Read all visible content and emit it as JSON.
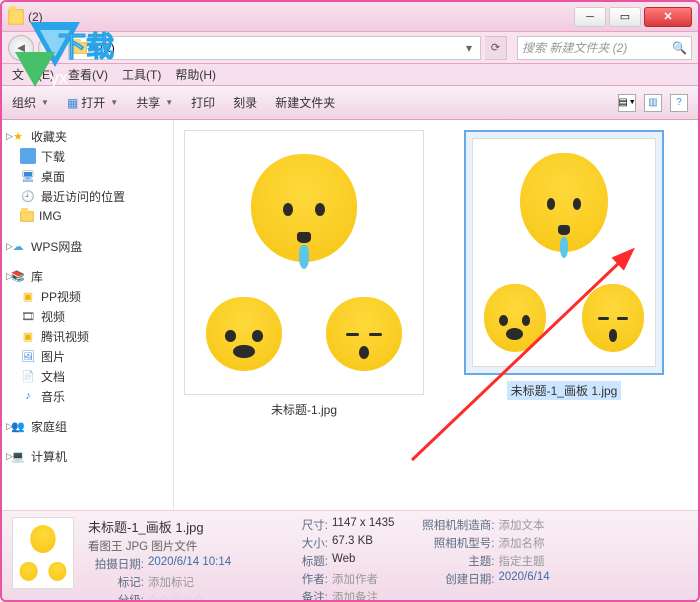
{
  "window": {
    "title_folder": "(2)"
  },
  "address": {
    "breadcrumb": "(2)",
    "refresh": "⟳"
  },
  "search": {
    "placeholder": "搜索 新建文件夹 (2)",
    "icon": "🔍"
  },
  "menubar": {
    "file": "文",
    "edit": "(E)",
    "view": "查看(V)",
    "tools": "工具(T)",
    "help": "帮助(H)"
  },
  "toolbar": {
    "organize": "组织",
    "open": "打开",
    "share": "共享",
    "print": "打印",
    "burn": "刻录",
    "newfolder": "新建文件夹"
  },
  "sidebar": {
    "favorites": "收藏夹",
    "downloads": "下载",
    "desktop": "桌面",
    "recent": "最近访问的位置",
    "img": "IMG",
    "wps": "WPS网盘",
    "libraries": "库",
    "ppvideo": "PP视频",
    "video": "视频",
    "tencent": "腾讯视频",
    "pictures": "图片",
    "documents": "文档",
    "music": "音乐",
    "homegroup": "家庭组",
    "computer": "计算机"
  },
  "files": {
    "item1": "未标题-1.jpg",
    "item2": "未标题-1_画板 1.jpg"
  },
  "details": {
    "filename": "未标题-1_画板 1.jpg",
    "filetype": "看图王 JPG 图片文件",
    "date_label": "拍摄日期:",
    "date_val": "2020/6/14 10:14",
    "tag_label": "标记:",
    "tag_val": "添加标记",
    "rating_label": "分级:",
    "dim_label": "尺寸:",
    "dim_val": "1147 x 1435",
    "size_label": "大小:",
    "size_val": "67.3 KB",
    "title_label": "标题:",
    "title_val": "Web",
    "author_label": "作者:",
    "author_val": "添加作者",
    "note_label": "备注:",
    "note_val": "添加备注",
    "maker_label": "照相机制造商:",
    "maker_val": "添加文本",
    "model_label": "照相机型号:",
    "model_val": "添加名称",
    "subject_label": "主题:",
    "subject_val": "指定主题",
    "created_label": "创建日期:",
    "created_val": "2020/6/14"
  },
  "watermark": {
    "text1": "下载",
    "text2": "yx"
  }
}
